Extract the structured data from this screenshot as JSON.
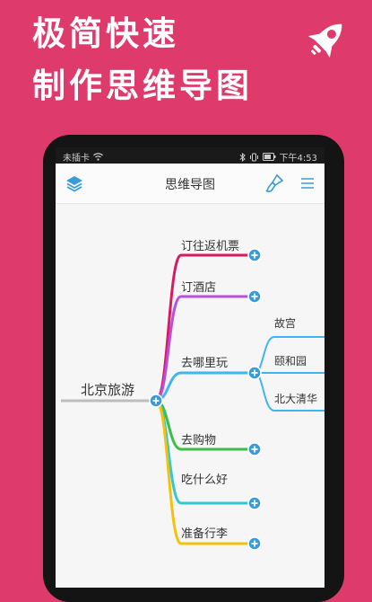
{
  "promo": {
    "headline_line1": "极简快速",
    "headline_line2": "制作思维导图",
    "badge_icon": "rocket-icon"
  },
  "colors": {
    "background": "#DE3A6C",
    "accent": "#3A9BD9",
    "branch_red": "#D81B60",
    "branch_purple": "#B94FE0",
    "branch_blue": "#3FB6F0",
    "branch_green": "#3DBE46",
    "branch_cyan": "#32C8D8",
    "branch_yellow": "#F4C20D"
  },
  "status_bar": {
    "carrier": "未插卡",
    "time": "下午4:53"
  },
  "app_bar": {
    "title": "思维导图",
    "left_icon": "layers-icon",
    "right_icons": [
      "paint-brush-icon",
      "menu-icon"
    ]
  },
  "mindmap": {
    "root": "北京旅游",
    "branches": [
      {
        "label": "订往返机票",
        "children": []
      },
      {
        "label": "订酒店",
        "children": []
      },
      {
        "label": "去哪里玩",
        "children": [
          "故宫",
          "颐和园",
          "北大清华"
        ]
      },
      {
        "label": "去购物",
        "children": []
      },
      {
        "label": "吃什么好",
        "children": []
      },
      {
        "label": "准备行李",
        "children": []
      }
    ]
  }
}
